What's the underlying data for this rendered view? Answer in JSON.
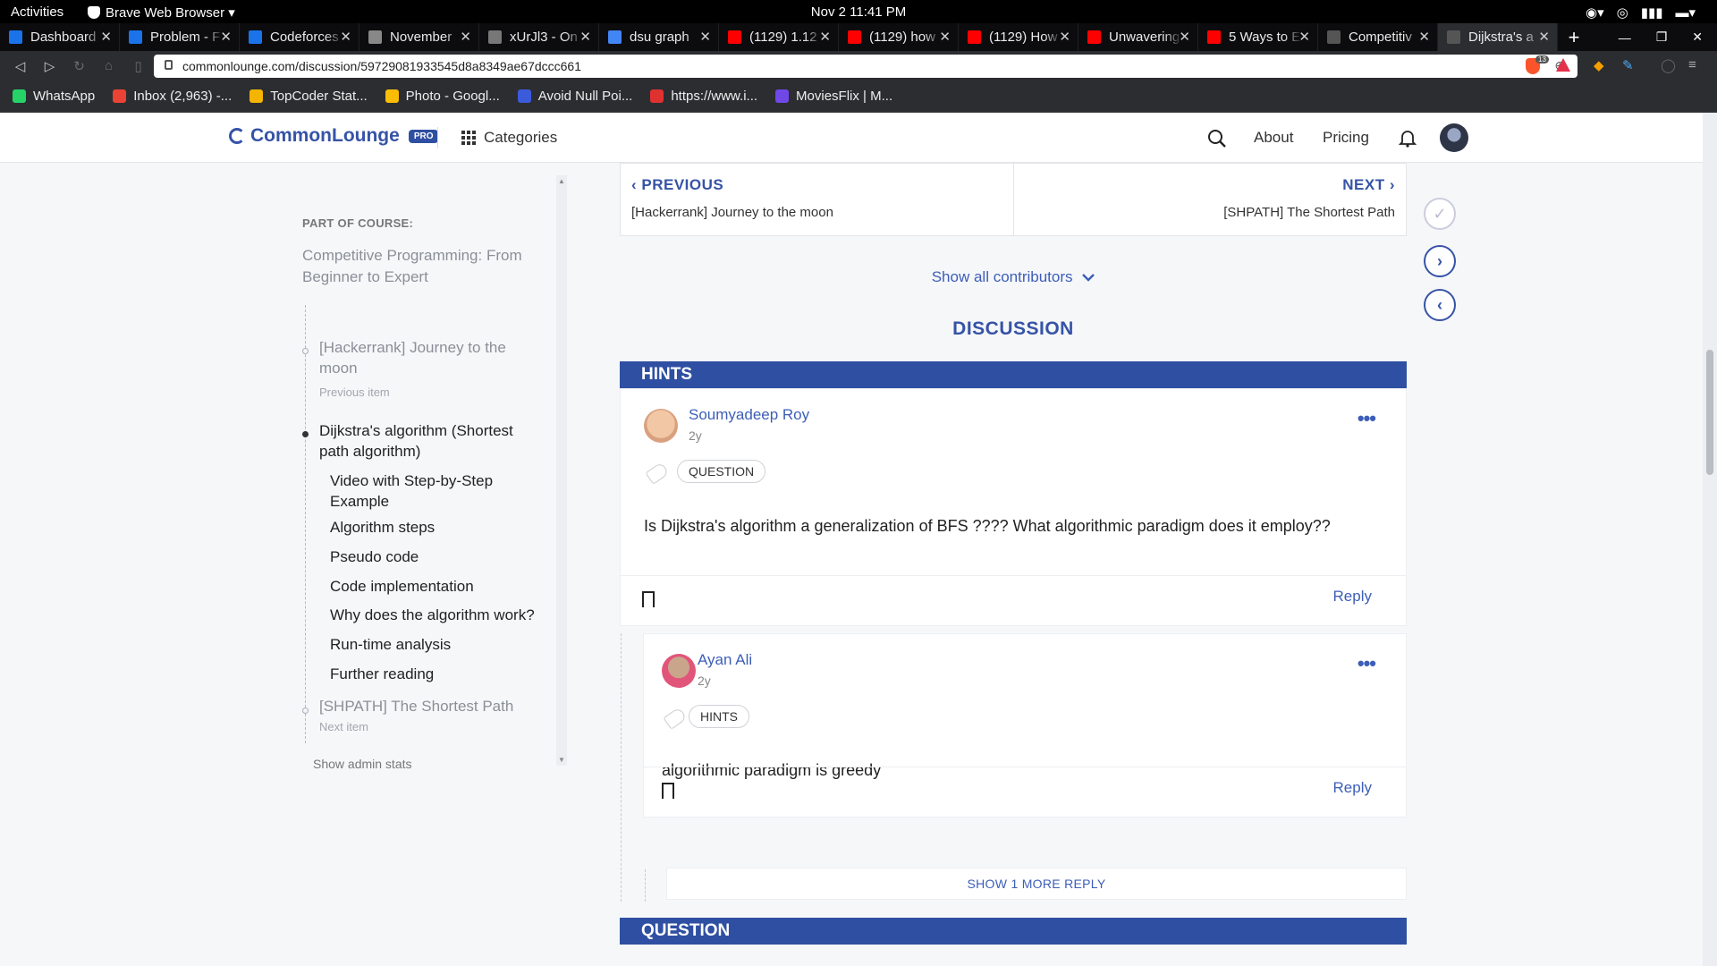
{
  "os": {
    "activities": "Activities",
    "app_name": "Brave Web Browser ▾",
    "clock": "Nov 2  11:41 PM"
  },
  "browser": {
    "tabs": [
      {
        "label": "Dashboard",
        "color": "#1a73e8"
      },
      {
        "label": "Problem - F",
        "color": "#1a73e8"
      },
      {
        "label": "Codeforces",
        "color": "#1a73e8"
      },
      {
        "label": "November",
        "color": "#888888"
      },
      {
        "label": "xUrJl3 - On",
        "color": "#777777"
      },
      {
        "label": "dsu graph",
        "color": "#4285f4"
      },
      {
        "label": "(1129) 1.12",
        "color": "#ff0000"
      },
      {
        "label": "(1129) how",
        "color": "#ff0000"
      },
      {
        "label": "(1129) How",
        "color": "#ff0000"
      },
      {
        "label": "Unwavering",
        "color": "#ff0000"
      },
      {
        "label": "5 Ways to E",
        "color": "#ff0000"
      },
      {
        "label": "Competitiv",
        "color": "#555555"
      },
      {
        "label": "Dijkstra's a",
        "color": "#555555",
        "active": true
      }
    ],
    "url": "commonlounge.com/discussion/59729081933545d8a8349ae67dccc661",
    "bookmarks": [
      {
        "label": "WhatsApp",
        "color": "#25d366"
      },
      {
        "label": "Inbox (2,963) -...",
        "color": "#ea4335"
      },
      {
        "label": "TopCoder Stat...",
        "color": "#f4b400"
      },
      {
        "label": "Photo - Googl...",
        "color": "#fbbc05"
      },
      {
        "label": "Avoid Null Poi...",
        "color": "#3b5bdb"
      },
      {
        "label": "https://www.i...",
        "color": "#e03131"
      },
      {
        "label": "MoviesFlix | M...",
        "color": "#7048e8"
      }
    ],
    "shields_count": "13"
  },
  "header": {
    "logo": "CommonLounge",
    "pro": "PRO",
    "categories": "Categories",
    "about": "About",
    "pricing": "Pricing"
  },
  "sidebar": {
    "part_of_course": "PART OF COURSE:",
    "course_title": "Competitive Programming: From Beginner to Expert",
    "previous_item": {
      "title": "[Hackerrank] Journey to the moon",
      "meta": "Previous item"
    },
    "current_item": {
      "title": "Dijkstra's algorithm (Shortest path algorithm)"
    },
    "sections": [
      "Video with Step-by-Step Example",
      "Algorithm steps",
      "Pseudo code",
      "Code implementation",
      "Why does the algorithm work?",
      "Run-time analysis",
      "Further reading"
    ],
    "next_item": {
      "title": "[SHPATH] The Shortest Path",
      "meta": "Next item"
    },
    "admin_stats": "Show admin stats"
  },
  "main": {
    "previous": {
      "label": "PREVIOUS",
      "title": "[Hackerrank] Journey to the moon"
    },
    "next": {
      "label": "NEXT",
      "title": "[SHPATH] The Shortest Path"
    },
    "show_contributors": "Show all contributors",
    "discussion_title": "DISCUSSION",
    "hints_header": "HINTS",
    "question_header": "QUESTION",
    "post": {
      "author": "Soumyadeep Roy",
      "age": "2y",
      "tag": "QUESTION",
      "body": "Is Dijkstra's algorithm a generalization of BFS ???? What algorithmic paradigm does it employ??",
      "reply": "Reply"
    },
    "reply_post": {
      "author": "Ayan Ali",
      "age": "2y",
      "tag": "HINTS",
      "body": "algorithmic paradigm is greedy",
      "reply": "Reply"
    },
    "show_more_reply": "SHOW 1 MORE REPLY"
  },
  "colors": {
    "brand": "#3653a6",
    "section_bar": "#2f4fa2",
    "link": "#3d5eb8"
  }
}
